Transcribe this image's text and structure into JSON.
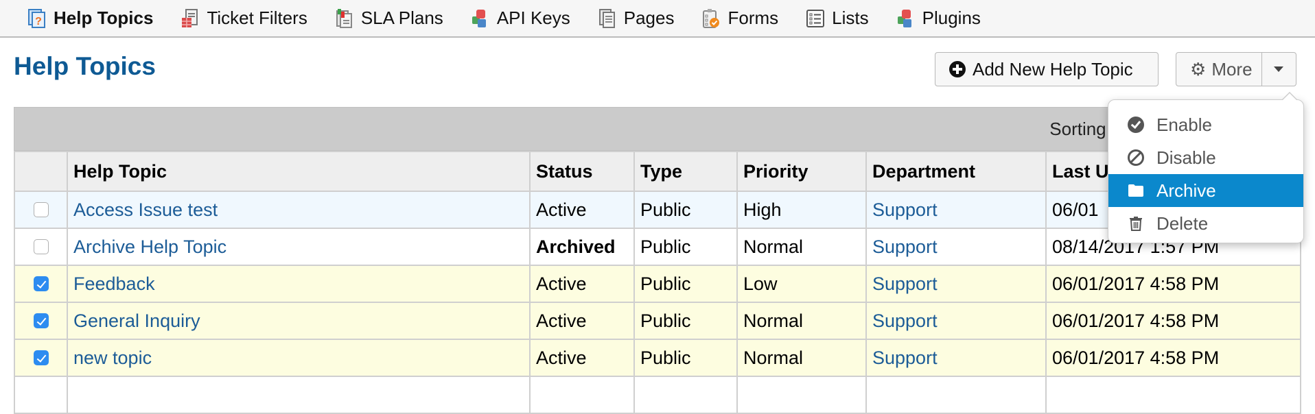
{
  "nav": {
    "items": [
      {
        "label": "Help Topics",
        "icon": "help-topics-icon",
        "active": true
      },
      {
        "label": "Ticket Filters",
        "icon": "ticket-filters-icon",
        "active": false
      },
      {
        "label": "SLA Plans",
        "icon": "sla-plans-icon",
        "active": false
      },
      {
        "label": "API Keys",
        "icon": "api-keys-icon",
        "active": false
      },
      {
        "label": "Pages",
        "icon": "pages-icon",
        "active": false
      },
      {
        "label": "Forms",
        "icon": "forms-icon",
        "active": false
      },
      {
        "label": "Lists",
        "icon": "lists-icon",
        "active": false
      },
      {
        "label": "Plugins",
        "icon": "plugins-icon",
        "active": false
      }
    ]
  },
  "header": {
    "title": "Help Topics",
    "add_button": "Add New Help Topic",
    "more_button": "More"
  },
  "table": {
    "sorting_label": "Sorting Mo",
    "columns": [
      "",
      "Help Topic",
      "Status",
      "Type",
      "Priority",
      "Department",
      "Last U"
    ],
    "rows": [
      {
        "checked": false,
        "topic": "Access Issue test",
        "status": "Active",
        "type": "Public",
        "priority": "High",
        "department": "Support",
        "updated": "06/01",
        "state": "hover"
      },
      {
        "checked": false,
        "topic": "Archive Help Topic",
        "status": "Archived",
        "type": "Public",
        "priority": "Normal",
        "department": "Support",
        "updated": "08/14/2017 1:57 PM",
        "state": "plain"
      },
      {
        "checked": true,
        "topic": "Feedback",
        "status": "Active",
        "type": "Public",
        "priority": "Low",
        "department": "Support",
        "updated": "06/01/2017 4:58 PM",
        "state": "selected"
      },
      {
        "checked": true,
        "topic": "General Inquiry",
        "status": "Active",
        "type": "Public",
        "priority": "Normal",
        "department": "Support",
        "updated": "06/01/2017 4:58 PM",
        "state": "selected"
      },
      {
        "checked": true,
        "topic": "new topic",
        "status": "Active",
        "type": "Public",
        "priority": "Normal",
        "department": "Support",
        "updated": "06/01/2017 4:58 PM",
        "state": "selected"
      }
    ]
  },
  "dropdown": {
    "items": [
      {
        "label": "Enable",
        "icon": "check-circle-icon",
        "active": false
      },
      {
        "label": "Disable",
        "icon": "ban-icon",
        "active": false
      },
      {
        "label": "Archive",
        "icon": "folder-icon",
        "active": true
      },
      {
        "label": "Delete",
        "icon": "trash-icon",
        "active": false
      }
    ]
  },
  "colors": {
    "title": "#0e5a94",
    "link": "#1c5c97",
    "menu_active": "#0b88cc",
    "selected_row": "#fdfde0",
    "hover_row": "#f0f8fe",
    "checkbox": "#2d8cf0"
  }
}
